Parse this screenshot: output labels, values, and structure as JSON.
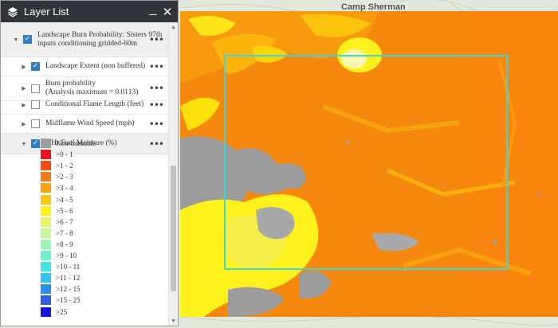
{
  "map": {
    "place_label": "Camp Sherman"
  },
  "panel": {
    "title": "Layer List",
    "minimize_glyph": "_",
    "close_glyph": "✕",
    "more_glyph": "•••",
    "layers": [
      {
        "label_lines": [
          "Landscape Burn Probability: Sisters 97th",
          "inputs conditioning gridded-60m"
        ],
        "checked": true,
        "expanded": true
      },
      {
        "label_lines": [
          "Landscape Extent (non buffered)"
        ],
        "checked": true,
        "expanded": false
      },
      {
        "label_lines": [
          "Burn probability",
          "(Analysis maximum = 0.0113)"
        ],
        "checked": false,
        "expanded": false
      },
      {
        "label_lines": [
          "Conditional Flame Length (feet)"
        ],
        "checked": false,
        "expanded": false
      },
      {
        "label_lines": [
          "Midflame Wind Speed (mph)"
        ],
        "checked": false,
        "expanded": false
      },
      {
        "label_lines": [
          "1 Hr Fuel Moisture (%)"
        ],
        "checked": true,
        "expanded": true
      }
    ]
  },
  "legend": [
    {
      "label": "Non-burnable",
      "color": "#9c9c9c"
    },
    {
      "label": ">0 - 1",
      "color": "#e8141c"
    },
    {
      "label": ">1 - 2",
      "color": "#f04e16"
    },
    {
      "label": ">2 - 3",
      "color": "#f47a12"
    },
    {
      "label": ">3 - 4",
      "color": "#f9a10f"
    },
    {
      "label": ">4 - 5",
      "color": "#fbc80c"
    },
    {
      "label": ">5 - 6",
      "color": "#fff21c"
    },
    {
      "label": ">6 - 7",
      "color": "#e8f56a"
    },
    {
      "label": ">7 - 8",
      "color": "#c8f59a"
    },
    {
      "label": ">8 - 9",
      "color": "#9cf5b8"
    },
    {
      "label": ">9 - 10",
      "color": "#6ef0cc"
    },
    {
      "label": ">10 - 11",
      "color": "#3ee6e6"
    },
    {
      "label": ">11 - 12",
      "color": "#2ec4ee"
    },
    {
      "label": ">12 - 15",
      "color": "#2a8ef0"
    },
    {
      "label": ">15 - 25",
      "color": "#2f5de8"
    },
    {
      "label": ">25",
      "color": "#1717d6"
    }
  ]
}
